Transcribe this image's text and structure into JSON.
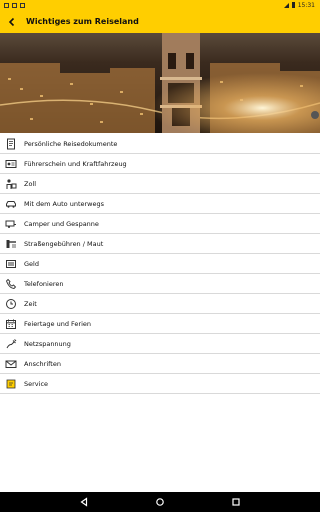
{
  "status": {
    "time": "15:31"
  },
  "appbar": {
    "title": "Wichtiges zum Reiseland",
    "back_icon": "back-arrow-icon"
  },
  "colors": {
    "accent": "#ffce00",
    "nav_bg": "#000000",
    "divider": "#d9d9d9"
  },
  "items": [
    {
      "label": "Persönliche Reisedokumente",
      "icon": "document-icon"
    },
    {
      "label": "Führerschein und Kraftfahrzeug",
      "icon": "license-icon"
    },
    {
      "label": "Zoll",
      "icon": "customs-icon"
    },
    {
      "label": "Mit dem Auto unterwegs",
      "icon": "car-icon"
    },
    {
      "label": "Camper und Gespanne",
      "icon": "camper-icon"
    },
    {
      "label": "Straßengebühren / Maut",
      "icon": "toll-icon"
    },
    {
      "label": "Geld",
      "icon": "money-icon"
    },
    {
      "label": "Telefonieren",
      "icon": "phone-icon"
    },
    {
      "label": "Zeit",
      "icon": "clock-icon"
    },
    {
      "label": "Feiertage und Ferien",
      "icon": "calendar-icon"
    },
    {
      "label": "Netzspannung",
      "icon": "plug-icon"
    },
    {
      "label": "Anschriften",
      "icon": "envelope-icon"
    },
    {
      "label": "Service",
      "icon": "service-icon"
    }
  ]
}
